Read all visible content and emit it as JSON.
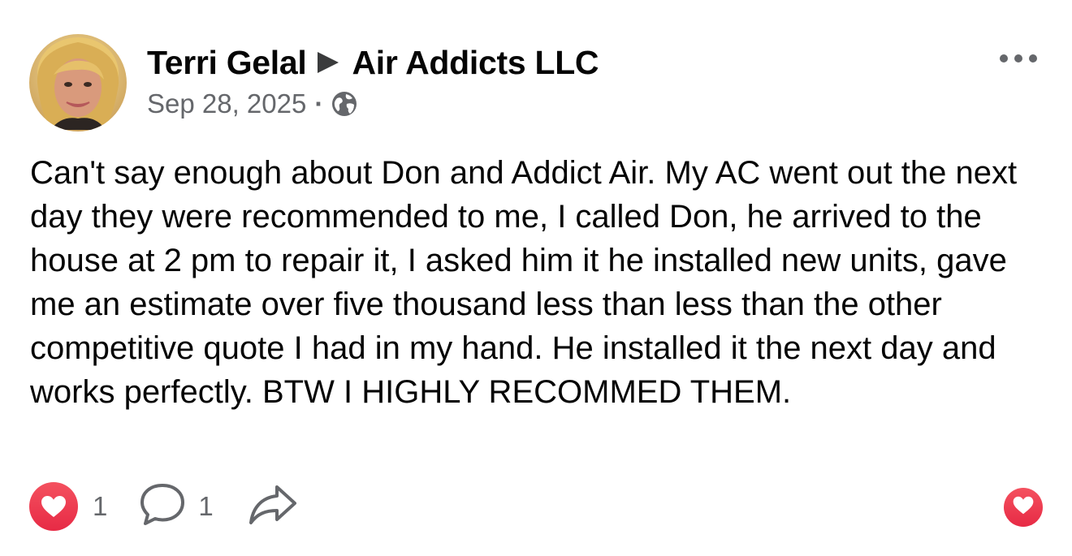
{
  "post": {
    "author": "Terri Gelal",
    "page": "Air Addicts LLC",
    "date": "Sep 28, 2025",
    "separator": "·",
    "privacy_icon": "globe-icon",
    "body": "Can't say enough about Don and Addict Air. My AC went out the next day they were recommended to me, I called Don, he arrived to the house at 2 pm to repair it, I asked him it he installed new units, gave me an estimate over five thousand less than less than the other competitive quote I had in my hand. He installed it the next day and works perfectly. BTW I HIGHLY RECOMMED THEM.",
    "menu_icon": "more-options-icon"
  },
  "footer": {
    "reaction_count": "1",
    "comment_count": "1",
    "reaction_icon": "heart-icon",
    "comment_icon": "comment-icon",
    "share_icon": "share-icon",
    "love_button_icon": "heart-icon"
  },
  "colors": {
    "text": "#050505",
    "secondary": "#65676b",
    "heart_red": "#e72a45"
  }
}
